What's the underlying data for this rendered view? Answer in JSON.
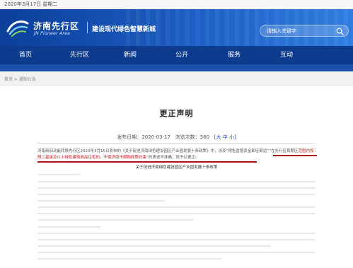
{
  "topbar": {
    "date": "2020年3月17日 星期二"
  },
  "header": {
    "logo_cn": "济南先行区",
    "logo_en": "JN Pioneer Area",
    "slogan": "建设现代绿色智慧新城",
    "search_placeholder": "请输入关键字"
  },
  "nav": {
    "items": [
      {
        "label": "首页"
      },
      {
        "label": "先行区"
      },
      {
        "label": "新闻"
      },
      {
        "label": "公开"
      },
      {
        "label": "服务"
      },
      {
        "label": "互动"
      }
    ]
  },
  "breadcrumb": "首页 > 通知公告",
  "article": {
    "title": "更正声明",
    "publish_label": "发布日期：",
    "publish_date": "2020-03-17",
    "views_label": "浏览次数：",
    "views": "560",
    "font_prefix": "[",
    "font_large": "大",
    "font_medium": "中",
    "font_small": "小",
    "font_suffix": "]",
    "para1_a": "济南新旧动能转换先行区2020年3月15日发布的《关于促进济南绿色建设园区产业园发展十条政策》中，涉及“预售监管资金即征即返”“在先行区首期区",
    "para1_hl": "范围内按照二星级及以上绿色建筑商品住宅的，不使济南市限购政策约束”",
    "para1_b": "的表述不准确，现予以更正。",
    "section_title": "关于促进济南绿色建设园区产业园发展十条政策"
  },
  "colors": {
    "nav_bg": "#0d3c8f",
    "banner_start": "#0b3f9a",
    "highlight_red": "#c8161e",
    "link_blue": "#1a4fb8"
  }
}
